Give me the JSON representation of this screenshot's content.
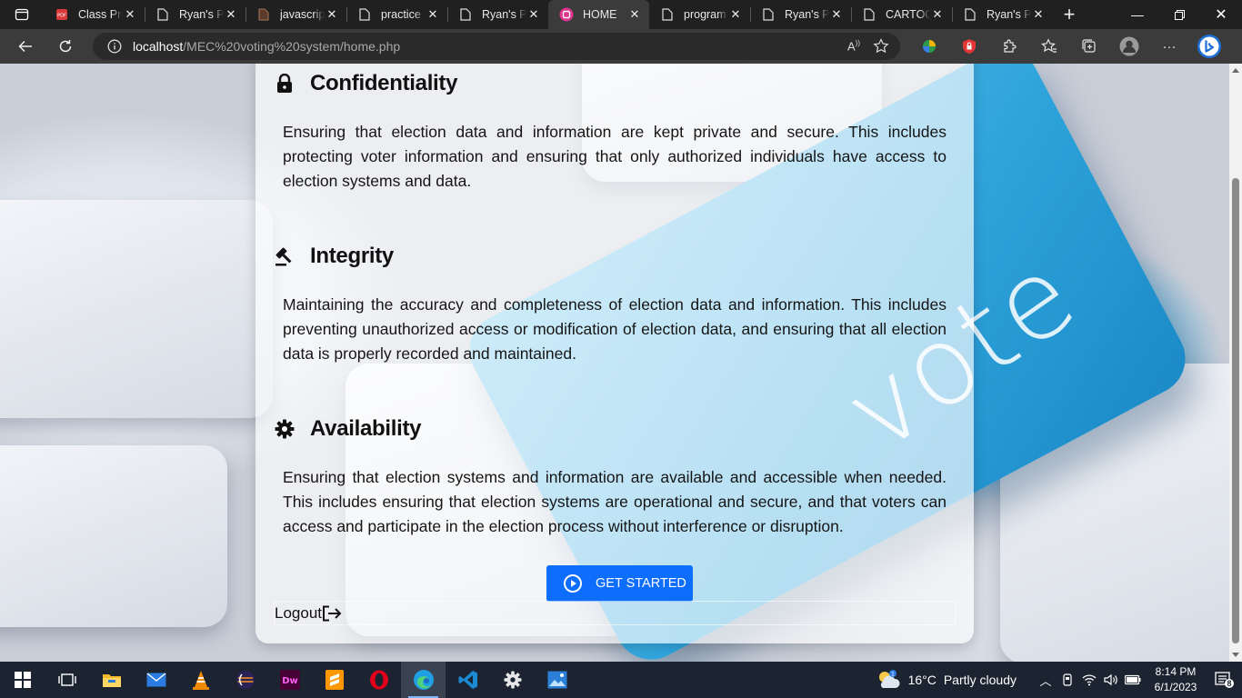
{
  "browser": {
    "tabs": [
      {
        "title": "Class Pro",
        "favicon": "pdf-icon",
        "active": false
      },
      {
        "title": "Ryan's Po",
        "favicon": "page-icon",
        "active": false
      },
      {
        "title": "javascript",
        "favicon": "page-icon",
        "active": false
      },
      {
        "title": "practice",
        "favicon": "page-icon",
        "active": false
      },
      {
        "title": "Ryan's Po",
        "favicon": "page-icon",
        "active": false
      },
      {
        "title": "HOME",
        "favicon": "site-icon",
        "active": true
      },
      {
        "title": "program",
        "favicon": "page-icon",
        "active": false
      },
      {
        "title": "Ryan's Po",
        "favicon": "page-icon",
        "active": false
      },
      {
        "title": "CARTOO",
        "favicon": "page-icon",
        "active": false
      },
      {
        "title": "Ryan's Po",
        "favicon": "page-icon",
        "active": false
      }
    ],
    "url_host": "localhost",
    "url_path": "/MEC%20voting%20system/home.php"
  },
  "page": {
    "sections": [
      {
        "icon": "lock-icon",
        "heading": "Confidentiality",
        "text": "Ensuring that election data and information are kept private and secure. This includes protecting voter information and ensuring that only authorized individuals have access to election systems and data."
      },
      {
        "icon": "gavel-icon",
        "heading": "Integrity",
        "text": "Maintaining the accuracy and completeness of election data and information. This includes preventing unauthorized access or modification of election data, and ensuring that all election data is properly recorded and maintained."
      },
      {
        "icon": "gear-icon",
        "heading": "Availability",
        "text": "Ensuring that election systems and information are available and accessible when needed. This includes ensuring that election systems are operational and secure, and that voters can access and participate in the election process without interference or disruption."
      }
    ],
    "cta_label": "GET STARTED",
    "logout_label": "Logout",
    "background_word": "vote"
  },
  "taskbar": {
    "apps": [
      "start-icon",
      "task-view-icon",
      "file-explorer-icon",
      "mail-icon",
      "vlc-icon",
      "eclipse-icon",
      "dreamweaver-icon",
      "sublime-icon",
      "opera-icon",
      "edge-icon",
      "vscode-icon",
      "settings-icon",
      "photos-icon"
    ],
    "weather_temp": "16°C",
    "weather_desc": "Partly cloudy",
    "time": "8:14 PM",
    "date": "6/1/2023",
    "notification_count": "8"
  },
  "colors": {
    "primary": "#0d6efd",
    "taskbar": "#1c2431",
    "chrome": "#3b3b3b"
  }
}
